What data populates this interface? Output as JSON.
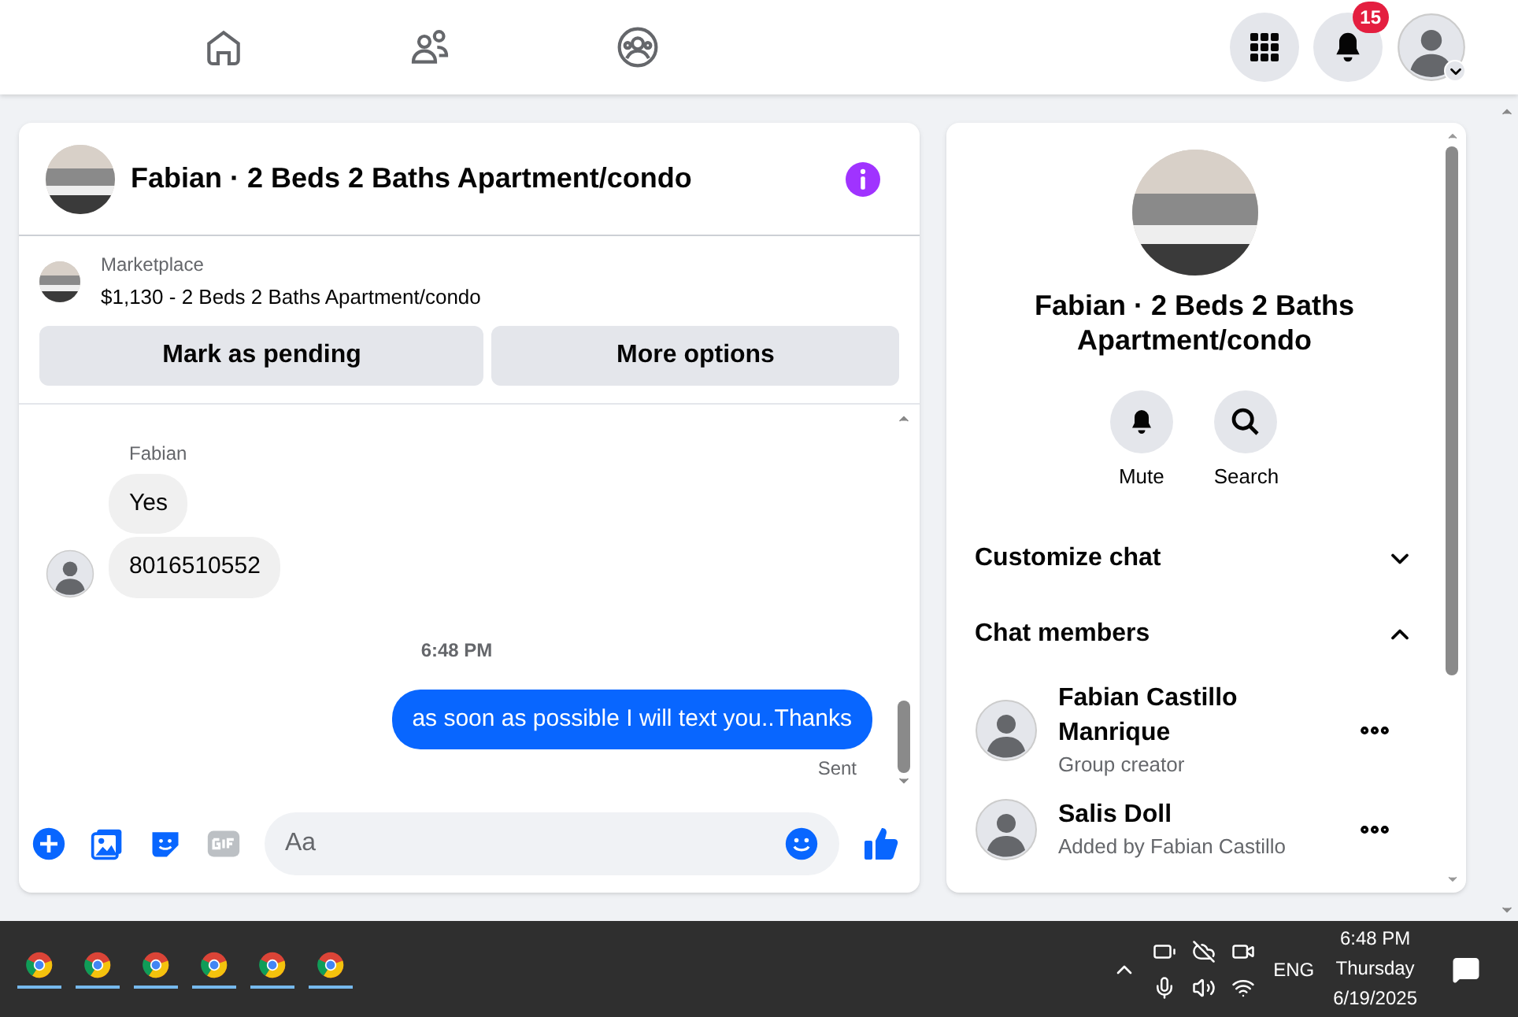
{
  "top_nav": {
    "notification_count": "15"
  },
  "conversation": {
    "title": "Fabian · 2 Beds 2 Baths Apartment/condo",
    "listing": {
      "source": "Marketplace",
      "summary": "$1,130 - 2 Beds 2 Baths Apartment/condo"
    },
    "actions": [
      "Mark as pending",
      "More options"
    ],
    "messages": [
      {
        "kind": "sender",
        "text": "Fabian"
      },
      {
        "kind": "incoming",
        "text": "Yes",
        "avatar": false
      },
      {
        "kind": "incoming",
        "text": "8016510552",
        "avatar": true
      },
      {
        "kind": "time",
        "text": "6:48 PM"
      },
      {
        "kind": "outgoing",
        "text": "as soon as possible I will text you..Thanks"
      },
      {
        "kind": "status",
        "text": "Sent"
      }
    ],
    "composer": {
      "placeholder": "Aa"
    }
  },
  "details": {
    "title": "Fabian · 2 Beds 2 Baths Apartment/condo",
    "actions": [
      {
        "kind": "bell",
        "label": "Mute"
      },
      {
        "kind": "search",
        "label": "Search"
      }
    ],
    "sections": [
      {
        "label": "Customize chat",
        "expanded": false
      },
      {
        "label": "Chat members",
        "expanded": true
      }
    ],
    "members": [
      {
        "name": "Fabian Castillo Manrique",
        "role": "Group creator"
      },
      {
        "name": "Salis Doll",
        "role": "Added by Fabian Castillo"
      }
    ]
  },
  "taskbar": {
    "language": "ENG",
    "time": "6:48 PM",
    "day": "Thursday",
    "date": "6/19/2025"
  }
}
